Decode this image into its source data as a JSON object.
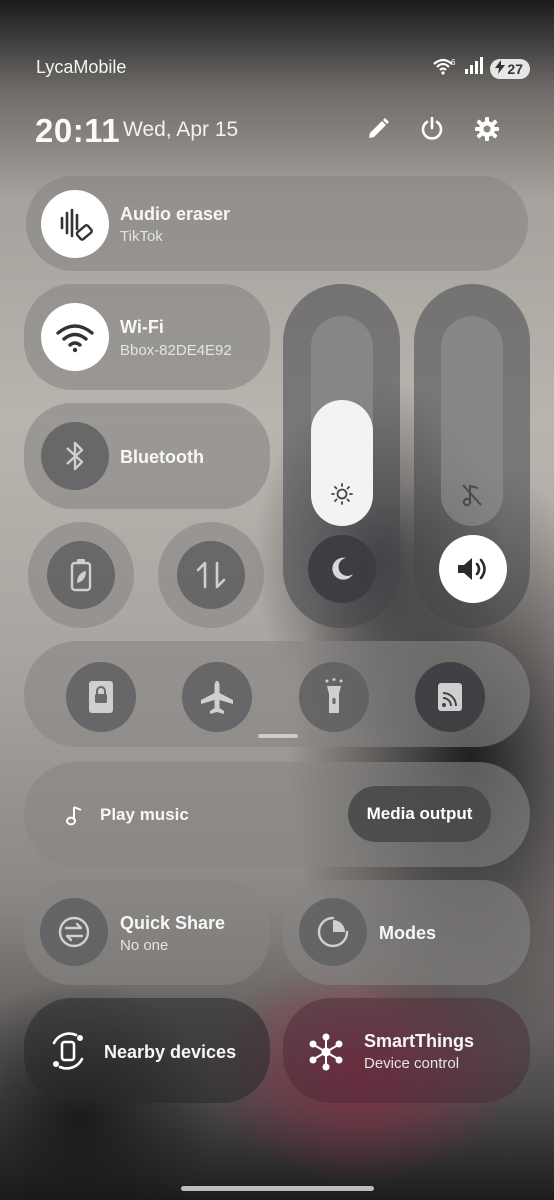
{
  "status": {
    "carrier": "LycaMobile",
    "battery_level": "27",
    "wifi_badge": "6"
  },
  "header": {
    "time": "20:11",
    "date": "Wed, Apr 15"
  },
  "tiles": {
    "audio_eraser": {
      "title": "Audio eraser",
      "subtitle": "TikTok"
    },
    "wifi": {
      "title": "Wi-Fi",
      "subtitle": "Bbox-82DE4E92"
    },
    "bluetooth": {
      "title": "Bluetooth"
    },
    "media": {
      "play_label": "Play music",
      "output_label": "Media output"
    },
    "quick_share": {
      "title": "Quick Share",
      "subtitle": "No one"
    },
    "modes": {
      "title": "Modes"
    },
    "nearby": {
      "title": "Nearby devices"
    },
    "smartthings": {
      "title": "SmartThings",
      "subtitle": "Device control"
    }
  },
  "sliders": {
    "brightness_level": 0.6,
    "volume_level": 0.0
  },
  "colors": {
    "active_toggle": "#ffffff",
    "tile_bg": "#7a7a7c",
    "accent_dark": "#2b2b2e"
  }
}
